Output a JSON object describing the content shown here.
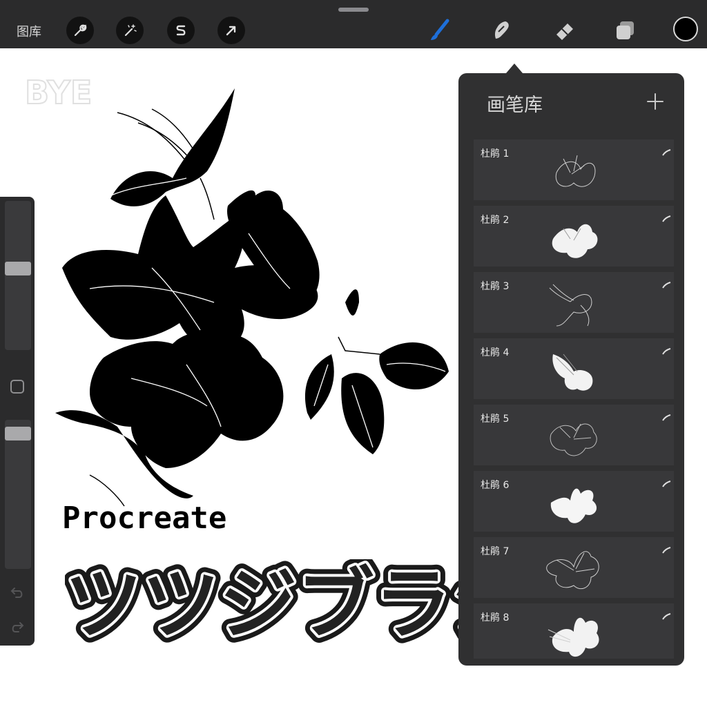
{
  "topbar": {
    "gallery_label": "图库",
    "left_tools": [
      "wrench-icon",
      "magic-wand-icon",
      "selection-s-icon",
      "arrow-move-icon"
    ],
    "right_tools": [
      "brush-icon",
      "smudge-icon",
      "eraser-icon",
      "layers-icon"
    ],
    "active_tool": "brush",
    "accent_color": "#1e6fd9",
    "current_color": "#000000"
  },
  "canvas": {
    "watermark": "BYE",
    "product_label": "Procreate",
    "title": "ツツジブラシ"
  },
  "sidebar": {
    "size_slider_level": 0.55,
    "opacity_slider_level": 0.95
  },
  "brush_library": {
    "title": "画笔库",
    "brushes": [
      {
        "name": "杜鹃 1"
      },
      {
        "name": "杜鹃 2"
      },
      {
        "name": "杜鹃 3"
      },
      {
        "name": "杜鹃 4"
      },
      {
        "name": "杜鹃 5"
      },
      {
        "name": "杜鹃 6"
      },
      {
        "name": "杜鹃 7"
      },
      {
        "name": "杜鹃 8"
      }
    ]
  }
}
